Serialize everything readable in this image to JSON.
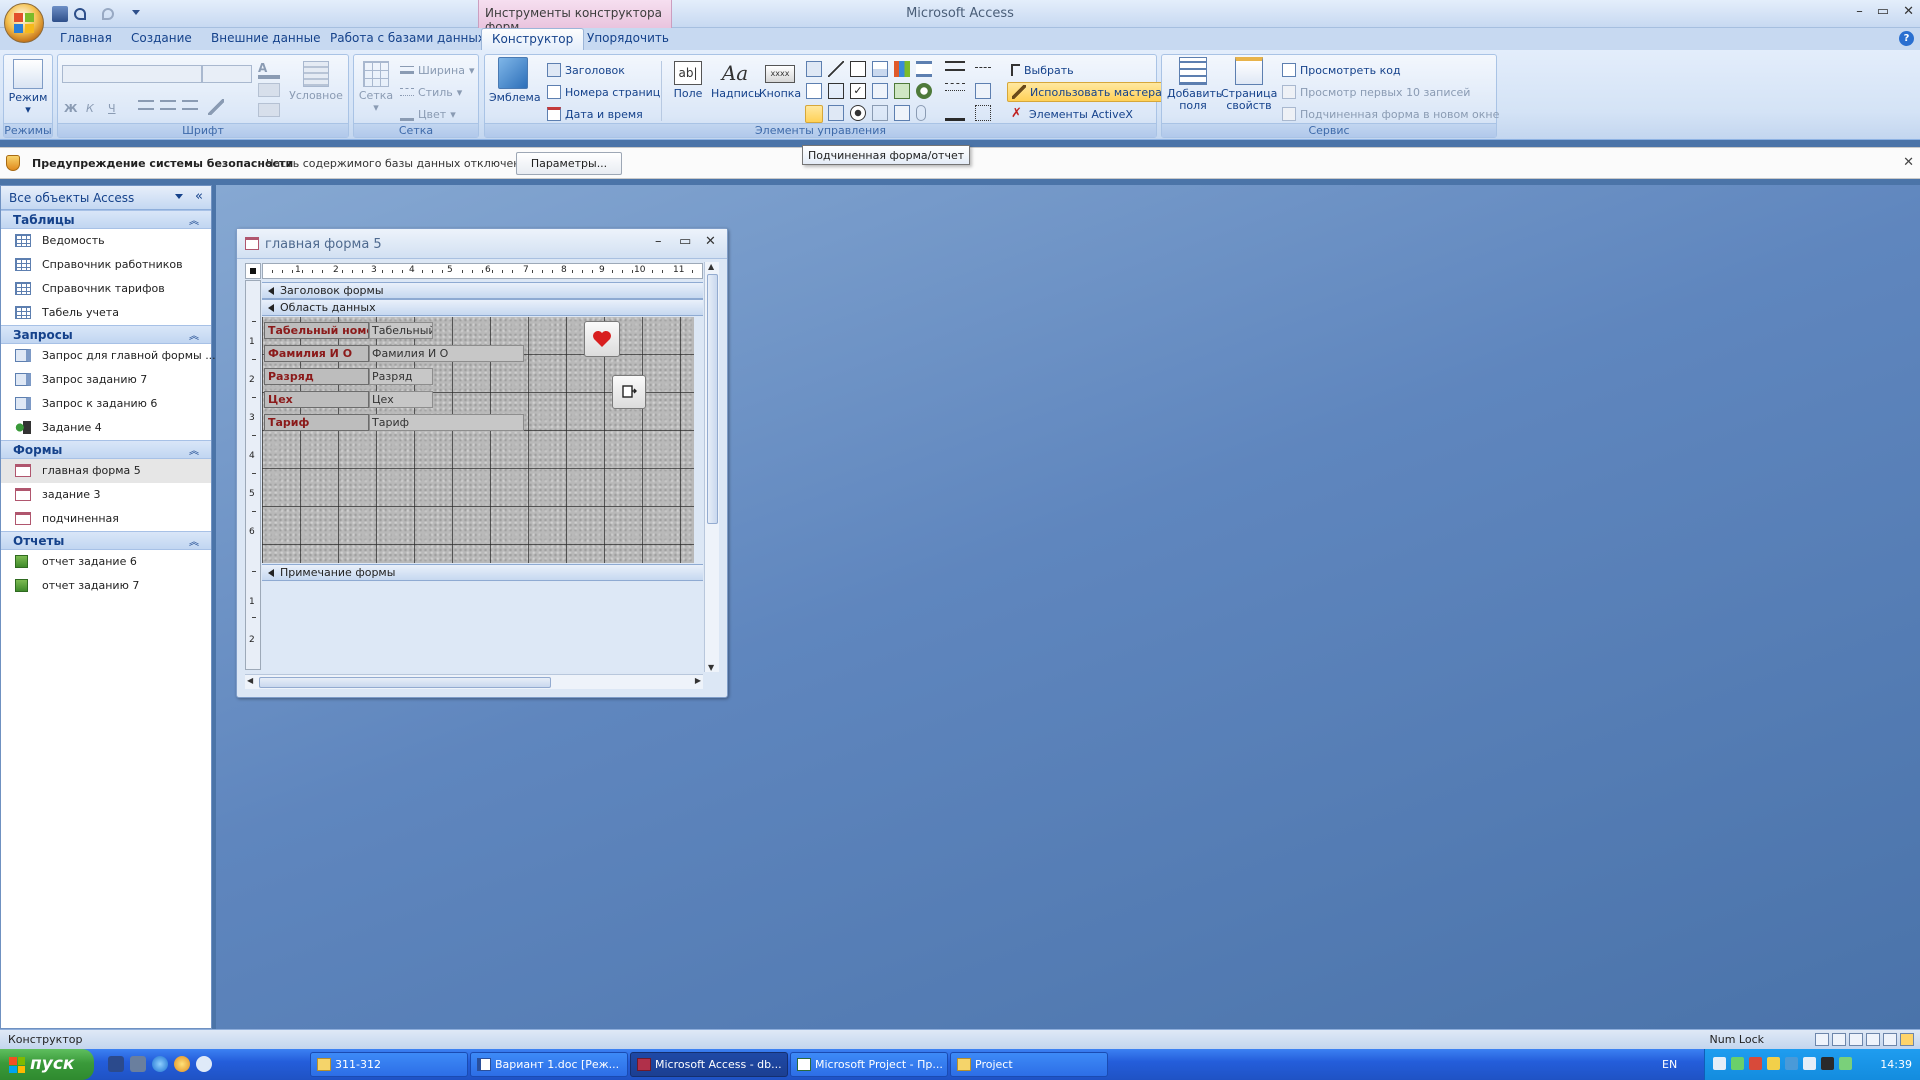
{
  "window": {
    "app_title": "Microsoft Access",
    "contextual_title": "Инструменты конструктора форм",
    "minimize": "–",
    "maximize": "▭",
    "close": "✕"
  },
  "tabs": [
    "Главная",
    "Создание",
    "Внешние данные",
    "Работа с базами данных",
    "Конструктор",
    "Упорядочить"
  ],
  "active_tab": "Конструктор",
  "ribbon": {
    "modes": {
      "view_label": "Режим",
      "group": "Режимы"
    },
    "font": {
      "group": "Шрифт",
      "bold": "Ж",
      "italic": "К",
      "underline": "Ч",
      "conditional": "Условное"
    },
    "grid": {
      "group": "Сетка",
      "grid_label": "Сетка",
      "width": "Ширина",
      "style": "Стиль",
      "color": "Цвет"
    },
    "controls": {
      "group": "Элементы управления",
      "logo": "Эмблема",
      "title": "Заголовок",
      "page_numbers": "Номера страниц",
      "date_time": "Дата и время",
      "field": "Поле",
      "label": "Надпись",
      "button": "Кнопка",
      "select": "Выбрать",
      "use_wizards": "Использовать мастера",
      "activex": "Элементы ActiveX"
    },
    "service": {
      "group": "Сервис",
      "add_fields": "Добавить поля",
      "property_sheet": "Страница свойств",
      "view_code": "Просмотреть код",
      "view_top10": "Просмотр первых 10 записей",
      "subform_new_window": "Подчиненная форма в новом окне"
    }
  },
  "security_bar": {
    "title": "Предупреждение системы безопасности",
    "text": "Часть содержимого базы данных отключено",
    "button": "Параметры...",
    "close": "✕"
  },
  "tooltip": "Подчиненная форма/отчет",
  "nav_pane": {
    "title": "Все объекты Access",
    "collapse": "«",
    "sections": [
      {
        "name": "Таблицы",
        "items": [
          "Ведомость",
          "Справочник работников",
          "Справочник тарифов",
          "Табель учета"
        ]
      },
      {
        "name": "Запросы",
        "items": [
          "Запрос для главной формы ...",
          "Запрос заданию 7",
          "Запрос к заданию 6",
          "Задание 4"
        ]
      },
      {
        "name": "Формы",
        "items": [
          "главная форма 5",
          "задание 3",
          "подчиненная"
        ]
      },
      {
        "name": "Отчеты",
        "items": [
          "отчет задание 6",
          "отчет заданию 7"
        ]
      }
    ],
    "selected": "главная форма 5"
  },
  "form_window": {
    "title": "главная форма 5",
    "ruler_numbers": [
      "1",
      "2",
      "3",
      "4",
      "5",
      "6",
      "7",
      "8",
      "9",
      "10",
      "11"
    ],
    "vruler_numbers": [
      "1",
      "2",
      "3",
      "4",
      "5",
      "6",
      "1",
      "2"
    ],
    "sections": {
      "header": "Заголовок формы",
      "detail": "Область данных",
      "footer": "Примечание формы"
    },
    "fields": [
      {
        "label": "Табельный номер",
        "value": "Табельный н"
      },
      {
        "label": "Фамилия И О",
        "value": "Фамилия И О"
      },
      {
        "label": "Разряд",
        "value": "Разряд"
      },
      {
        "label": "Цех",
        "value": "Цех"
      },
      {
        "label": "Тариф",
        "value": "Тариф"
      }
    ]
  },
  "status_bar": {
    "left": "Конструктор",
    "right": "Num Lock"
  },
  "taskbar": {
    "start": "пуск",
    "tasks": [
      "311-312",
      "Вариант 1.doc [Реж...",
      "Microsoft Access - db...",
      "Microsoft Project - Пр...",
      "Project"
    ],
    "active_task": 2,
    "language": "EN",
    "clock": "14:39"
  },
  "colors": {
    "ribbon_text": "#15428b",
    "label_text": "#8b1a1a",
    "mdi_background": "#5f86be",
    "taskbar": "#245edb",
    "start_button": "#3a9a3a"
  }
}
